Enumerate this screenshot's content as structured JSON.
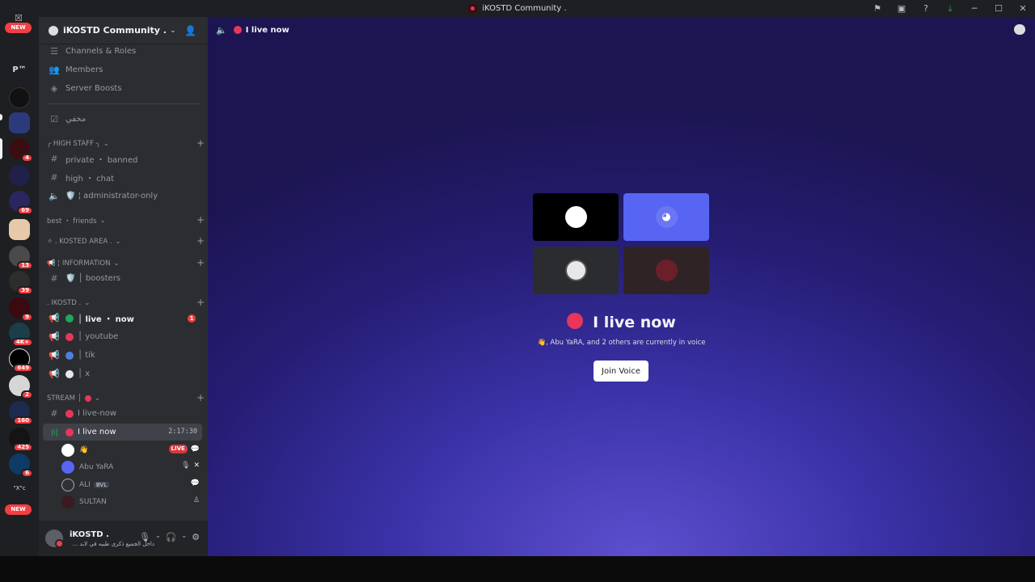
{
  "window": {
    "title": "iKOSTD Community ."
  },
  "rail": {
    "new_top": "NEW",
    "new_bottom": "NEW",
    "p_label": "P™",
    "x_label": "\"X\"c",
    "badges": [
      "4",
      "69",
      "13",
      "39",
      "9",
      "4K+",
      "649",
      "2",
      "160",
      "425",
      "6"
    ]
  },
  "server": {
    "name": "iKOSTD Community .",
    "menu": [
      {
        "label": "Channels & Roles",
        "icon": "list-icon"
      },
      {
        "label": "Members",
        "icon": "members-icon"
      },
      {
        "label": "Server Boosts",
        "icon": "boost-icon"
      }
    ]
  },
  "channels": {
    "hidden": "مخفي",
    "high_staff": "╭ HIGH STAFF ╮",
    "private_banned": "private ・ banned",
    "high_chat": "high ・ chat",
    "admin_only": "🛡️ ¦ administrator-only",
    "best_friends": "best ・ friends",
    "kosted_area": "✧ . KOSTED AREA .",
    "information": "📢 ¦ INFORMATION",
    "boosters": "🛡️ │ boosters",
    "ikostd_cat": ". IKOSTD .",
    "live_now_voice": "│ live ・ now",
    "live_now_mentions": "1",
    "youtube": "│ youtube",
    "tik": "│ tik",
    "x": "│ x",
    "stream_cat": "STREAM │",
    "live_now_text": "I live-now",
    "live_now_stage": "I live now",
    "stage_timer": "2:17:30"
  },
  "voice_users": {
    "u1_name": "👋",
    "u1_live": "LIVE",
    "u2_name": "Abu YaRA",
    "u3_name": "ALI",
    "u3_tag": "BVL",
    "u4_name": "SULTAN"
  },
  "user_panel": {
    "name": "iKOSTD .",
    "status": "داخل الجميع ذكرى طيبه في لابد ..."
  },
  "stage": {
    "header_title": "I live now",
    "title": "I live now",
    "subtitle": "👋, Abu YaRA, and 2 others are currently in voice",
    "join_label": "Join Voice"
  },
  "colors": {
    "accent": "#5865f2",
    "live_red": "#e8365a",
    "online_green": "#23a55a",
    "blue": "#4d7fe0"
  }
}
